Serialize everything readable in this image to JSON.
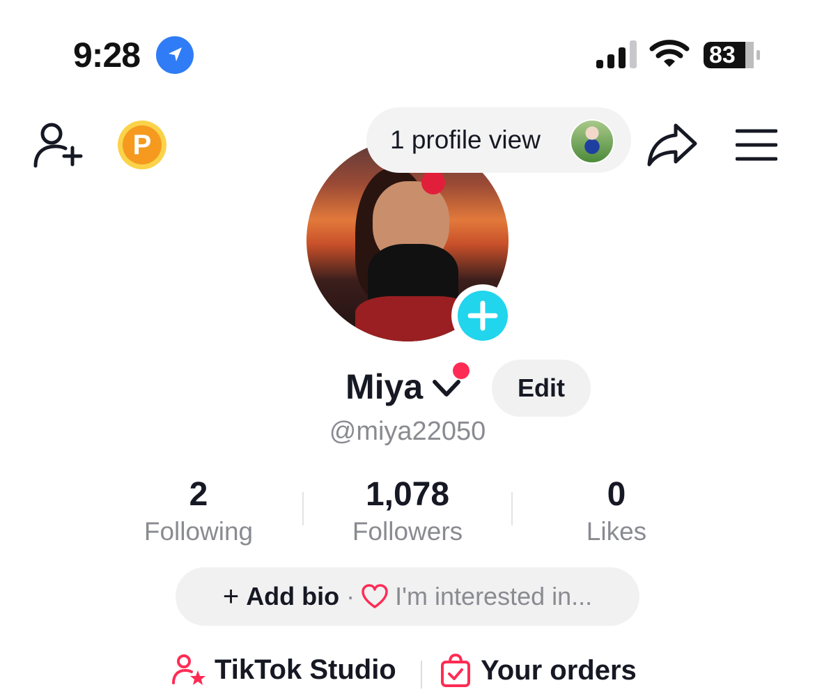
{
  "status_bar": {
    "time": "9:28",
    "battery": "83",
    "icons": [
      "location-arrow-icon",
      "signal-icon",
      "wifi-icon",
      "battery-icon"
    ]
  },
  "header": {
    "profile_views": "1 profile view",
    "icons": [
      "add-user-icon",
      "p-coin-icon",
      "share-icon",
      "menu-icon"
    ],
    "coin_letter": "P"
  },
  "profile": {
    "name": "Miya",
    "username": "@miya22050",
    "edit_label": "Edit"
  },
  "stats": [
    {
      "value": "2",
      "label": "Following"
    },
    {
      "value": "1,078",
      "label": "Followers"
    },
    {
      "value": "0",
      "label": "Likes"
    }
  ],
  "bio": {
    "plus": "+",
    "add_label": "Add bio",
    "separator": "·",
    "interest_label": "I'm interested in..."
  },
  "links": {
    "studio_label": "TikTok Studio",
    "orders_label": "Your orders"
  },
  "colors": {
    "accent": "#fe2c55",
    "plus_badge": "#20d5ec",
    "location": "#2f7cf6",
    "coin": "#f5a623",
    "secondary_text": "#8a8b91"
  }
}
